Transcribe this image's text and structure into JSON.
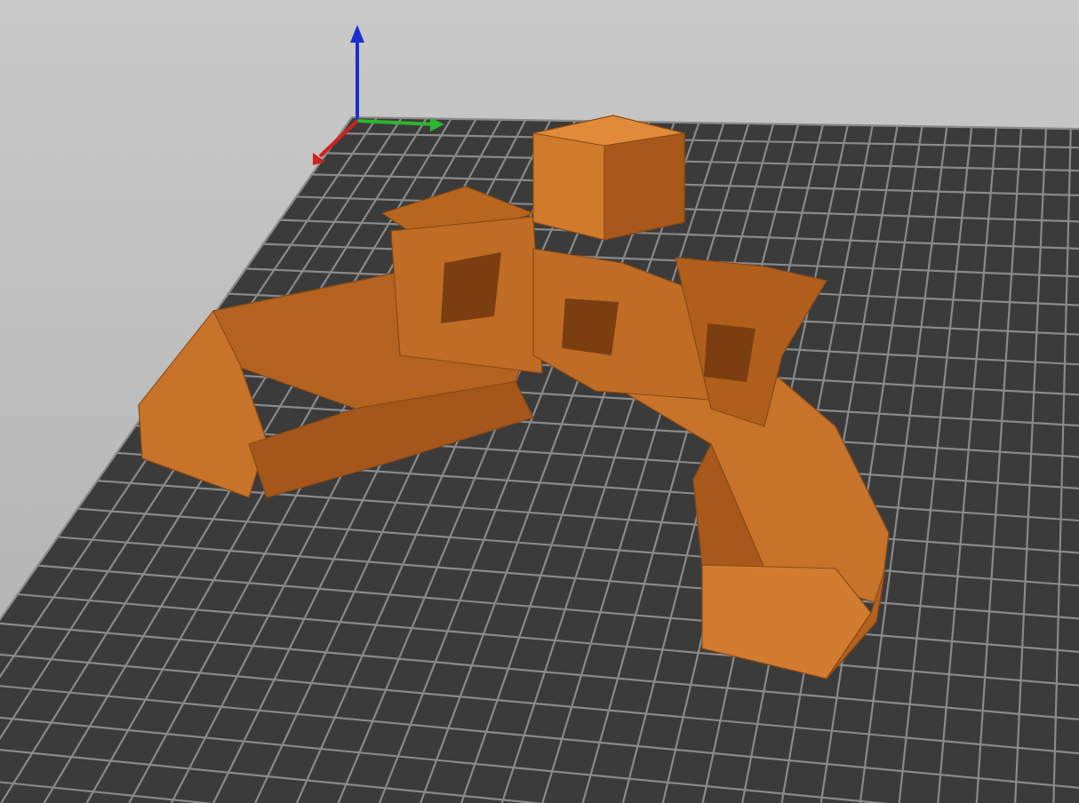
{
  "view": {
    "axes_visible": true,
    "bed_grid_visible": true
  }
}
